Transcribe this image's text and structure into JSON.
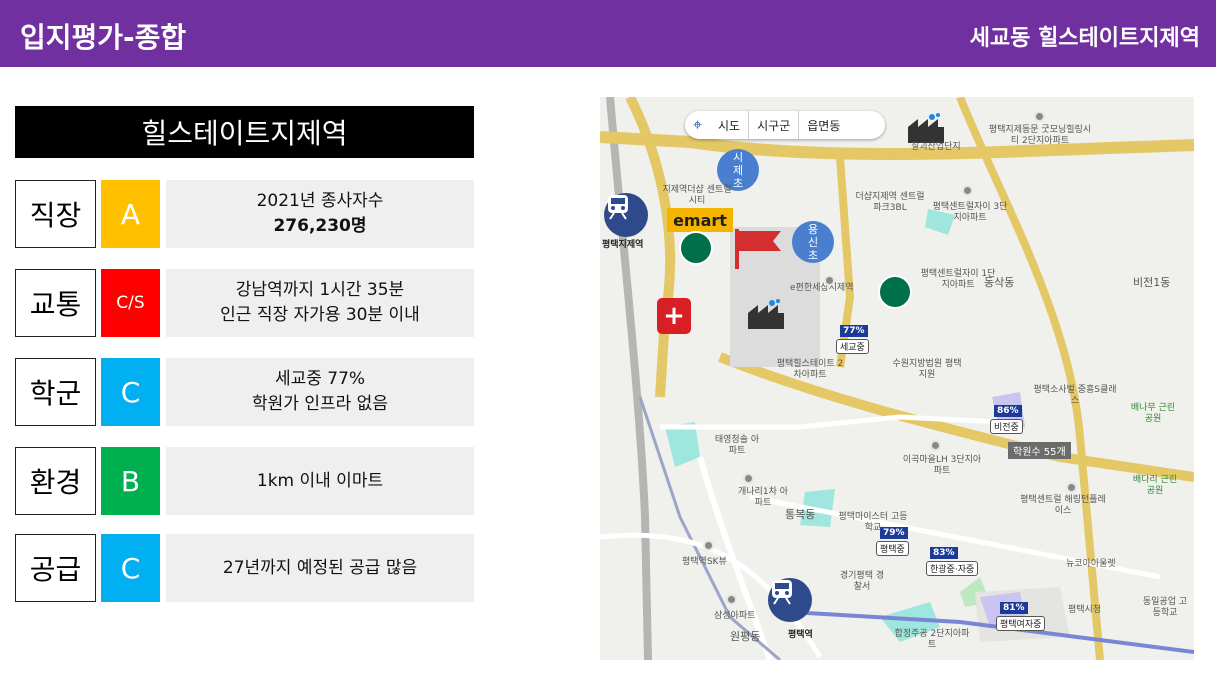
{
  "header": {
    "title": "입지평가-종합",
    "subtitle": "세교동 힐스테이트지제역"
  },
  "site_name": "힐스테이트지제역",
  "rows": [
    {
      "category": "직장",
      "grade": "A",
      "grade_color": "#ffc000",
      "line1": "2021년 종사자수",
      "line2": "276,230명",
      "line2_bold": true
    },
    {
      "category": "교통",
      "grade": "C/S",
      "grade_color": "#ff0000",
      "line1": "강남역까지 1시간 35분",
      "line2": "인근 직장 자가용 30분 이내"
    },
    {
      "category": "학군",
      "grade": "C",
      "grade_color": "#00b0f0",
      "line1": "세교중 77%",
      "line2": "학원가 인프라 없음"
    },
    {
      "category": "환경",
      "grade": "B",
      "grade_color": "#00b050",
      "line1": "1km 이내 이마트",
      "line2": ""
    },
    {
      "category": "공급",
      "grade": "C",
      "grade_color": "#00b0f0",
      "line1": "27년까지 예정된 공급 많음",
      "line2": ""
    }
  ],
  "map": {
    "buttons": [
      "시도",
      "시구군",
      "읍면동"
    ],
    "circles": [
      {
        "text": "시\n제\n초"
      },
      {
        "text": "용\n신\n초"
      }
    ],
    "emart": "emart",
    "stations": [
      "평택지제역",
      "평택역"
    ],
    "schools": [
      {
        "pct": "77%",
        "name": "세교중"
      },
      {
        "pct": "86%",
        "name": "비전중"
      },
      {
        "pct": "79%",
        "name": "평택중"
      },
      {
        "pct": "83%",
        "name": "한광중·자중"
      },
      {
        "pct": "81%",
        "name": "평택여자중"
      }
    ],
    "academy_tag": "학원수 55개",
    "places": [
      "칠괴산업단지",
      "평택지제동문 굿모닝힐링시티 2단지아파트",
      "지제역더샵 센트럴시티",
      "더샵지제역 센트럴파크3BL",
      "평택센트럴자이 3단지아파트",
      "평택센트럴자이 1단지아파트",
      "e편한세상지제역",
      "평택힐스테이트 2차아파트",
      "수원지방법원 평택지원",
      "동삭동",
      "비전1동",
      "평택소사벌 중흥S클래스",
      "배나무 근린공원",
      "배다리 근린공원",
      "태영청솔 아파트",
      "이곡마을LH 3단지아파트",
      "평택센트럴 해링턴플레이스",
      "개나리1차 아파트",
      "통복동",
      "평택마이스터 고등학교",
      "경기평택 경찰서",
      "평택역SK뷰",
      "삼성아파트",
      "원평동",
      "합정주공 2단지아파트",
      "뉴코아아울렛",
      "평택시청",
      "동일공업 고등학교"
    ]
  }
}
